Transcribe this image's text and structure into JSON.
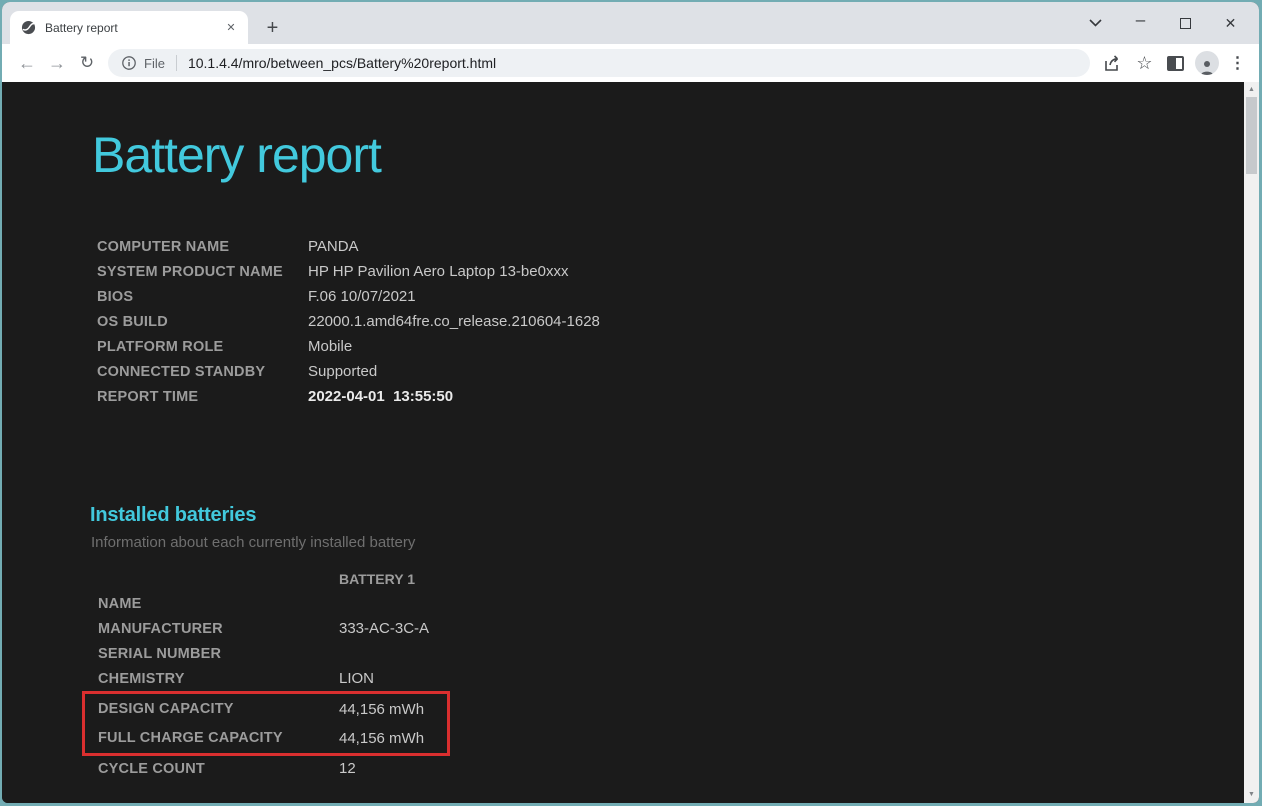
{
  "browser": {
    "tab_title": "Battery report",
    "url_scheme_label": "File",
    "url": "10.1.4.4/mro/between_pcs/Battery%20report.html"
  },
  "icons": {
    "new_tab": "+",
    "minimize": "–",
    "close_window": "✕",
    "tab_close": "✕",
    "back": "←",
    "forward": "→",
    "reload": "↻",
    "bookmark_star": "☆",
    "menu_dots": "⋮",
    "scroll_up": "▲",
    "scroll_down": "▼"
  },
  "page": {
    "title": "Battery report",
    "system_info": {
      "rows": [
        {
          "label": "COMPUTER NAME",
          "value": "PANDA"
        },
        {
          "label": "SYSTEM PRODUCT NAME",
          "value": "HP HP Pavilion Aero Laptop 13-be0xxx"
        },
        {
          "label": "BIOS",
          "value": "F.06 10/07/2021"
        },
        {
          "label": "OS BUILD",
          "value": "22000.1.amd64fre.co_release.210604-1628"
        },
        {
          "label": "PLATFORM ROLE",
          "value": "Mobile"
        },
        {
          "label": "CONNECTED STANDBY",
          "value": "Supported"
        },
        {
          "label": "REPORT TIME",
          "value": "2022-04-01  13:55:50"
        }
      ]
    },
    "installed_batteries": {
      "heading": "Installed batteries",
      "subheading": "Information about each currently installed battery",
      "column_header": "BATTERY 1",
      "rows": [
        {
          "label": "NAME",
          "value": ""
        },
        {
          "label": "MANUFACTURER",
          "value": "333-AC-3C-A"
        },
        {
          "label": "SERIAL NUMBER",
          "value": ""
        },
        {
          "label": "CHEMISTRY",
          "value": "LION"
        },
        {
          "label": "DESIGN CAPACITY",
          "value": "44,156 mWh"
        },
        {
          "label": "FULL CHARGE CAPACITY",
          "value": "44,156 mWh"
        },
        {
          "label": "CYCLE COUNT",
          "value": "12"
        }
      ]
    },
    "colors": {
      "accent_cyan": "#42c9dd",
      "highlight_red": "#da2f2f",
      "page_background": "#1b1b1b",
      "window_frame_teal": "#72acb3"
    }
  }
}
